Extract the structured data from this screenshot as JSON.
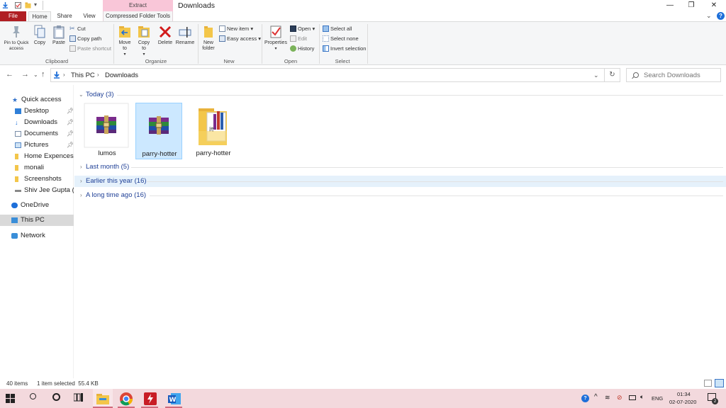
{
  "window": {
    "title": "Downloads",
    "contextual_header": "Extract",
    "controls": {
      "minimize": "—",
      "maximize": "❐",
      "close": "✕"
    }
  },
  "ribbon": {
    "tabs": {
      "file": "File",
      "home": "Home",
      "share": "Share",
      "view": "View",
      "contextual": "Compressed Folder Tools"
    },
    "clipboard": {
      "label": "Clipboard",
      "pin_to_quick_access": "Pin to Quick access",
      "copy": "Copy",
      "paste": "Paste",
      "cut": "Cut",
      "copy_path": "Copy path",
      "paste_shortcut": "Paste shortcut"
    },
    "organize": {
      "label": "Organize",
      "move_to": "Move to",
      "copy_to": "Copy to",
      "delete": "Delete",
      "rename": "Rename"
    },
    "new": {
      "label": "New",
      "new_folder": "New folder",
      "new_item": "New item",
      "easy_access": "Easy access"
    },
    "open": {
      "label": "Open",
      "properties": "Properties",
      "open": "Open",
      "edit": "Edit",
      "history": "History"
    },
    "select": {
      "label": "Select",
      "select_all": "Select all",
      "select_none": "Select none",
      "invert_selection": "Invert selection"
    }
  },
  "address": {
    "crumbs": [
      "This PC",
      "Downloads"
    ],
    "search_placeholder": "Search Downloads"
  },
  "nav_pane": {
    "items": [
      {
        "label": "Quick access",
        "icon": "star-icon",
        "pinned": false
      },
      {
        "label": "Desktop",
        "icon": "desktop-icon",
        "pinned": true
      },
      {
        "label": "Downloads",
        "icon": "download-arrow-icon",
        "pinned": true
      },
      {
        "label": "Documents",
        "icon": "documents-icon",
        "pinned": true
      },
      {
        "label": "Pictures",
        "icon": "pictures-icon",
        "pinned": true
      },
      {
        "label": "Home Expences",
        "icon": "folder-icon",
        "pinned": false
      },
      {
        "label": "monali",
        "icon": "folder-icon",
        "pinned": false
      },
      {
        "label": "Screenshots",
        "icon": "folder-icon",
        "pinned": false
      },
      {
        "label": "Shiv Jee Gupta (E",
        "icon": "drive-icon",
        "pinned": false
      },
      {
        "label": "OneDrive",
        "icon": "cloud-icon",
        "pinned": false
      },
      {
        "label": "This PC",
        "icon": "pc-icon",
        "pinned": false,
        "selected": true
      },
      {
        "label": "Network",
        "icon": "network-icon",
        "pinned": false
      }
    ]
  },
  "content": {
    "groups": [
      {
        "label": "Today (3)",
        "expanded": true
      },
      {
        "label": "Last month (5)",
        "expanded": false
      },
      {
        "label": "Earlier this year (16)",
        "expanded": false,
        "hover": true
      },
      {
        "label": "A long time ago (16)",
        "expanded": false
      }
    ],
    "files": [
      {
        "name": "lumos",
        "type": "rar-archive-icon",
        "selected": false
      },
      {
        "name": "parry-hotter",
        "type": "rar-archive-icon",
        "selected": true
      },
      {
        "name": "parry-hotter",
        "type": "folder-with-archive-icon",
        "selected": false
      }
    ]
  },
  "statusbar": {
    "item_count": "40 items",
    "selection": "1 item selected  55.4 KB"
  },
  "taskbar": {
    "time": "01:34",
    "date": "02-07-2020",
    "lang": "ENG",
    "notification_count": "2"
  },
  "colors": {
    "file_tab": "#b01e23",
    "contextual_tab": "#f9c6d8",
    "selection": "#cce8ff",
    "group_header_text": "#1e3f96",
    "taskbar": "#f3d9dd"
  }
}
